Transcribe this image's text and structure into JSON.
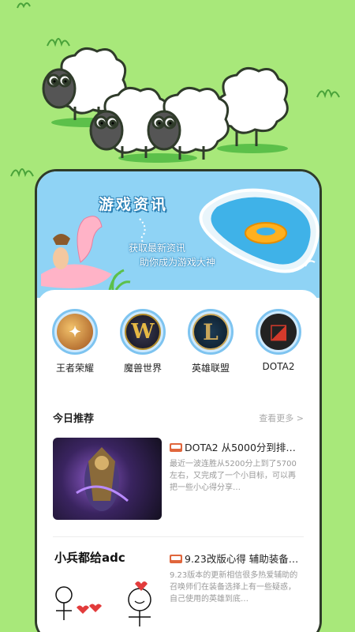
{
  "banner": {
    "title": "游戏资讯",
    "subtitle_line1": "获取最新资讯",
    "subtitle_line2": "助你成为游戏大神"
  },
  "games": [
    {
      "label": "王者荣耀",
      "icon": "honor-of-kings-icon"
    },
    {
      "label": "魔兽世界",
      "icon": "world-of-warcraft-icon"
    },
    {
      "label": "英雄联盟",
      "icon": "league-of-legends-icon"
    },
    {
      "label": "DOTA2",
      "icon": "dota2-icon"
    }
  ],
  "section": {
    "title": "今日推荐",
    "more": "查看更多 >"
  },
  "articles": [
    {
      "title": "DOTA2 从5000分到排…",
      "desc": "最近一波连胜从5200分上到了5700左右，又完成了一个小目标，可以再把一些小心得分享…"
    },
    {
      "thumb_text": "小兵都给adc",
      "title": "9.23改版心得  辅助装备…",
      "desc": "9.23版本的更新相信很多热爱辅助的召唤师们在装备选择上有一些疑惑，自己使用的英雄到底…"
    }
  ],
  "colors": {
    "background": "#a8e87a",
    "banner": "#8fd3f5",
    "accent": "#e0663c"
  }
}
